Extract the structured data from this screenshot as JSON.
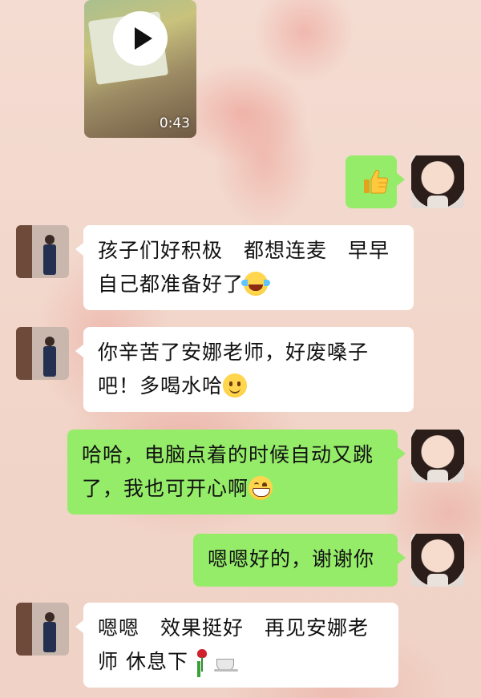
{
  "video": {
    "duration": "0:43",
    "icon": "play-icon"
  },
  "messages": [
    {
      "side": "right",
      "type": "emoji",
      "icon": "thumbs-up-icon"
    },
    {
      "side": "left",
      "line1": "孩子们好积极　都想连麦　早早",
      "line2": "自己都准备好了",
      "emoji": "laugh-cry-emoji-icon"
    },
    {
      "side": "left",
      "line1": "你辛苦了安娜老师，好废嗓子",
      "line2": "吧！多喝水哈",
      "emoji": "smile-emoji-icon"
    },
    {
      "side": "right",
      "line1": "哈哈，电脑点着的时候自动又跳",
      "line2": "了，我也可开心啊",
      "emoji": "grin-emoji-icon"
    },
    {
      "side": "right",
      "line1": "嗯嗯好的，谢谢你"
    },
    {
      "side": "left",
      "line1": "嗯嗯　效果挺好　再见安娜老",
      "line2": "师 休息下",
      "emoji": [
        "rose-emoji-icon",
        "coffee-emoji-icon"
      ]
    }
  ],
  "colors": {
    "green_bubble": "#95ec69",
    "white_bubble": "#ffffff",
    "background": "#f3d9cf"
  }
}
